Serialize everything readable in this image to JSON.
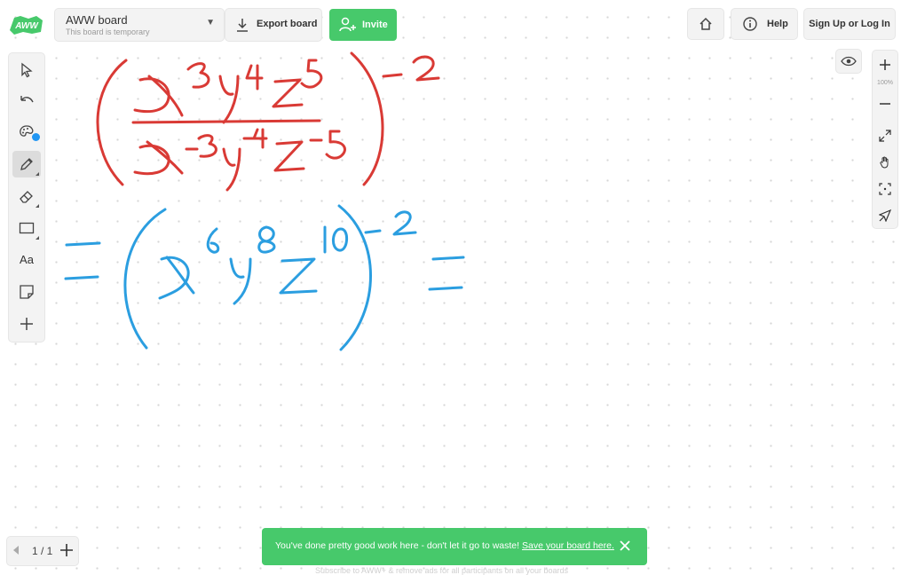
{
  "app": {
    "logo_text": "AWW",
    "board_title": "AWW board",
    "board_subtitle": "This board is temporary"
  },
  "header": {
    "export_label": "Export board",
    "invite_label": "Invite",
    "help_label": "Help",
    "signup_label": "Sign Up or Log In"
  },
  "zoom": {
    "level": "100%"
  },
  "pages": {
    "indicator": "1 / 1"
  },
  "toast": {
    "message": "You've done pretty good work here - don't let it go to waste!",
    "link": "Save your board here."
  },
  "bottom_note": "Subscribe to AWW+ & remove ads for all participants on all your boards",
  "tools": {
    "text_tool_label": "Aa",
    "active_tool": "pencil",
    "palette_color": "#2196f3"
  },
  "colors": {
    "accent_green": "#47c96b",
    "ink_red": "#d93a35",
    "ink_blue": "#2b9ee0"
  },
  "drawing": {
    "red_expression": {
      "numerator": [
        "x",
        "3",
        "y",
        "4",
        "z",
        "5"
      ],
      "denominator": [
        "x",
        "-3",
        "y",
        "-4",
        "z",
        "-5"
      ],
      "outer_exponent": "-2"
    },
    "blue_expression": {
      "lead": "=",
      "terms": [
        "x",
        "6",
        "y",
        "8",
        "z",
        "10"
      ],
      "outer_exponent": "-2",
      "trail": "="
    }
  }
}
